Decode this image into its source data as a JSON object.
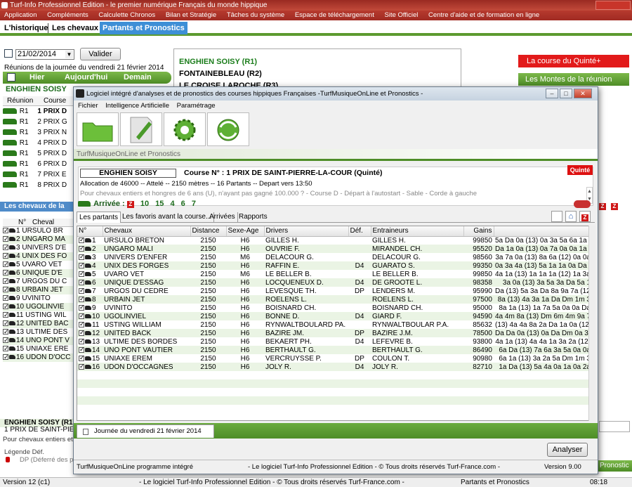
{
  "app": {
    "title": "Turf-Info Professionnel Edition - le premier numérique Français du monde hippique",
    "menu": [
      "Application",
      "Compléments",
      "Calculette Chronos",
      "Bilan et Stratégie",
      "Tâches du système",
      "Espace de téléchargement",
      "Site Officiel",
      "Centre d'aide et de formation en ligne"
    ]
  },
  "tabs": [
    "L'historique",
    "Les chevaux",
    "Partants et Pronostics"
  ],
  "date": {
    "value": "21/02/2014",
    "validate": "Valider",
    "caption": "Réunions de la journée du vendredi 21 février 2014",
    "nav": [
      "Hier",
      "Aujourd'hui",
      "Demain"
    ]
  },
  "reunions": [
    "ENGHIEN SOISY (R1)",
    "FONTAINEBLEAU (R2)",
    "LE CROISE LAROCHE (R3)"
  ],
  "right_buttons": {
    "quinte": "La course du Quinté+",
    "montes": "Les Montes de la réunion"
  },
  "left": {
    "title": "ENGHIEN SOISY",
    "headers": [
      "Réunion",
      "Course"
    ],
    "races": [
      {
        "r": "R1",
        "c": "1 PRIX D"
      },
      {
        "r": "R1",
        "c": "2 PRIX G"
      },
      {
        "r": "R1",
        "c": "3 PRIX N"
      },
      {
        "r": "R1",
        "c": "4 PRIX D"
      },
      {
        "r": "R1",
        "c": "5 PRIX D"
      },
      {
        "r": "R1",
        "c": "6 PRIX D"
      },
      {
        "r": "R1",
        "c": "7 PRIX E"
      },
      {
        "r": "R1",
        "c": "8 PRIX D"
      }
    ],
    "horses_bar": "Les chevaux de la co",
    "horse_headers": [
      "N°",
      "Cheval"
    ],
    "horses": [
      {
        "n": "1",
        "name": "URSULO BR"
      },
      {
        "n": "2",
        "name": "UNGARO MA"
      },
      {
        "n": "3",
        "name": "UNIVERS D'E"
      },
      {
        "n": "4",
        "name": "UNIX DES FO"
      },
      {
        "n": "5",
        "name": "UVARO VET"
      },
      {
        "n": "6",
        "name": "UNIQUE D'E"
      },
      {
        "n": "7",
        "name": "URGOS DU C"
      },
      {
        "n": "8",
        "name": "URBAIN JET"
      },
      {
        "n": "9",
        "name": "UVINITO"
      },
      {
        "n": "10",
        "name": "UGOLINVIE"
      },
      {
        "n": "11",
        "name": "USTING WIL"
      },
      {
        "n": "12",
        "name": "UNITED BAC"
      },
      {
        "n": "13",
        "name": "ULTIME DES"
      },
      {
        "n": "14",
        "name": "UNO PONT V"
      },
      {
        "n": "15",
        "name": "UNIAXE ERE"
      },
      {
        "n": "16",
        "name": "UDON D'OCC"
      }
    ],
    "bottom_title": "ENGHIEN SOISY (R1)",
    "bottom_race": "1 PRIX DE SAINT-PIERRE-",
    "bottom_cond": "Pour chevaux entiers et h",
    "legend_title": "Légende Déf.",
    "legend_dp": "DP (Déferré des p"
  },
  "modal": {
    "title": "Logiciel intégré d'analyses et de pronostics des courses hippiques Françaises       -TurfMusiqueOnLine et Pronostics -",
    "menu": [
      "Fichier",
      "Intelligence Artificielle",
      "Paramétrage"
    ],
    "brand": "TurfMusiqueOnLine et Pronostics",
    "hippodrome": "ENGHIEN SOISY",
    "course": "Course N° : 1 PRIX DE SAINT-PIERRE-LA-COUR (Quinté)",
    "quinte": "Quinté",
    "alloc": "Allocation de 46000 -- Attelé -- 2150 mètres -- 16 Partants -- Depart vers 13:50",
    "cond": "Pour chevaux entiers et hongres de 6 ans (U), n'ayant pas gagné 100.000 ? - Course D - Départ à l'autostart - Sable - Corde à gauche",
    "arrivee_label": "Arrivée :",
    "arrivee": [
      "10",
      "15",
      "4",
      "6",
      "7"
    ],
    "tabs": [
      "Les partants",
      "Les favoris avant la course...",
      "Arrivées",
      "Rapports"
    ],
    "columns": [
      "N°",
      "Chevaux",
      "Distance",
      "Sexe-Age",
      "Drivers",
      "Déf.",
      "Entraineurs",
      "Gains",
      ""
    ],
    "runners": [
      {
        "n": "1",
        "name": "URSULO BRETON",
        "dist": "2150",
        "sa": "H6",
        "driver": "GILLES H.",
        "def": "",
        "trainer": "GILLES H.",
        "gains": "99850",
        "musique": "5a Da 0a (13) 0a 3a 5a 6a 1a 3"
      },
      {
        "n": "2",
        "name": "UNGARO MALI",
        "dist": "2150",
        "sa": "H6",
        "driver": "OUVRIE F.",
        "def": "",
        "trainer": "MIRANDEL CH.",
        "gains": "95520",
        "musique": "Da 1a 0a (13) 0a 7a 0a 0a 1a 1"
      },
      {
        "n": "3",
        "name": "UNIVERS D'ENFER",
        "dist": "2150",
        "sa": "M6",
        "driver": "DELACOUR G.",
        "def": "",
        "trainer": "DELACOUR G.",
        "gains": "98560",
        "musique": "3a 7a 0a (13) 8a 6a (12) 0a 0a"
      },
      {
        "n": "4",
        "name": "UNIX DES FORGES",
        "dist": "2150",
        "sa": "H6",
        "driver": "RAFFIN E.",
        "def": "D4",
        "trainer": "GUARATO S.",
        "gains": "99350",
        "musique": "0a 3a 4a (13) 5a 1a 1a 0a Da 2"
      },
      {
        "n": "5",
        "name": "UVARO VET",
        "dist": "2150",
        "sa": "M6",
        "driver": "LE BELLER B.",
        "def": "",
        "trainer": "LE BELLER B.",
        "gains": "99850",
        "musique": "4a 1a (13) 1a 1a 1a (12) 1a 3a 3a"
      },
      {
        "n": "6",
        "name": "UNIQUE D'ESSAG",
        "dist": "2150",
        "sa": "H6",
        "driver": "LOCQUENEUX D.",
        "def": "D4",
        "trainer": "DE GROOTE L.",
        "gains": "98358",
        "musique": "3a 0a (13) 3a 5a 3a Da 5a 1"
      },
      {
        "n": "7",
        "name": "URGOS DU CEDRE",
        "dist": "2150",
        "sa": "H6",
        "driver": "LEVESQUE TH.",
        "def": "DP",
        "trainer": "LENDERS M.",
        "gains": "95990",
        "musique": "Da (13) 5a 3a Da 8a 9a 7a (12) 4"
      },
      {
        "n": "8",
        "name": "URBAIN JET",
        "dist": "2150",
        "sa": "H6",
        "driver": "ROELENS L.",
        "def": "",
        "trainer": "ROELENS L.",
        "gains": "97500",
        "musique": "8a (13) 4a 3a 1a Da Dm 1m 3"
      },
      {
        "n": "9",
        "name": "UVINITO",
        "dist": "2150",
        "sa": "H6",
        "driver": "BOISNARD CH.",
        "def": "",
        "trainer": "BOISNARD CH.",
        "gains": "95000",
        "musique": "8a 1a (13) 1a 7a 5a 0a 0a Da"
      },
      {
        "n": "10",
        "name": "UGOLINVIEL",
        "dist": "2150",
        "sa": "H6",
        "driver": "BONNE D.",
        "def": "D4",
        "trainer": "GIARD F.",
        "gains": "94590",
        "musique": "4a 4m 8a (13) Dm 6m 4m 9a 7m"
      },
      {
        "n": "11",
        "name": "USTING WILLIAM",
        "dist": "2150",
        "sa": "H6",
        "driver": "RYNWALTBOULARD PA.",
        "def": "",
        "trainer": "RYNWALTBOULAR P.A.",
        "gains": "85632",
        "musique": "(13) 4a 4a 8a 2a Da 1a 0a (12)"
      },
      {
        "n": "12",
        "name": "UNITED BACK",
        "dist": "2150",
        "sa": "H6",
        "driver": "BAZIRE JM.",
        "def": "DP",
        "trainer": "BAZIRE J.M.",
        "gains": "78500",
        "musique": "Da Da 0a (13) 0a Da Dm 0a 3m"
      },
      {
        "n": "13",
        "name": "ULTIME DES BORDES",
        "dist": "2150",
        "sa": "H6",
        "driver": "BEKAERT PH.",
        "def": "D4",
        "trainer": "LEFEVRE B.",
        "gains": "93800",
        "musique": "4a 1a (13) 4a 4a 1a 3a 2a (12)"
      },
      {
        "n": "14",
        "name": "UNO PONT VAUTIER",
        "dist": "2150",
        "sa": "H6",
        "driver": "BERTHAULT G.",
        "def": "",
        "trainer": "BERTHAULT G.",
        "gains": "86490",
        "musique": "6a Da (13) 7a 6a 3a 5a 0a 0a"
      },
      {
        "n": "15",
        "name": "UNIAXE EREM",
        "dist": "2150",
        "sa": "H6",
        "driver": "VERCRUYSSE P.",
        "def": "DP",
        "trainer": "COULON T.",
        "gains": "90980",
        "musique": "6a 1a (13) 3a 2a 5a Dm 1m 3"
      },
      {
        "n": "16",
        "name": "UDON D'OCCAGNES",
        "dist": "2150",
        "sa": "H6",
        "driver": "JOLY R.",
        "def": "D4",
        "trainer": "JOLY R.",
        "gains": "82710",
        "musique": "1a Da (13) 5a 4a 0a 1a 0a 2a"
      }
    ],
    "journee": "Journée du vendredi 21 février 2014",
    "analyser": "Analyser",
    "status": [
      "TurfMusiqueOnLine programme intégré",
      "- Le logiciel Turf-Info Professionnel Edition - © Tous droits réservés Turf-France.com -",
      "Version 9.00"
    ]
  },
  "statusbar": {
    "left": "Version 12 (c1)",
    "center": "- Le logiciel Turf-Info Professionnel Edition - © Tous droits réservés Turf-France.com -",
    "tab": "Partants et Pronostics",
    "time": "08:18",
    "right_tab": "Pronostic"
  }
}
